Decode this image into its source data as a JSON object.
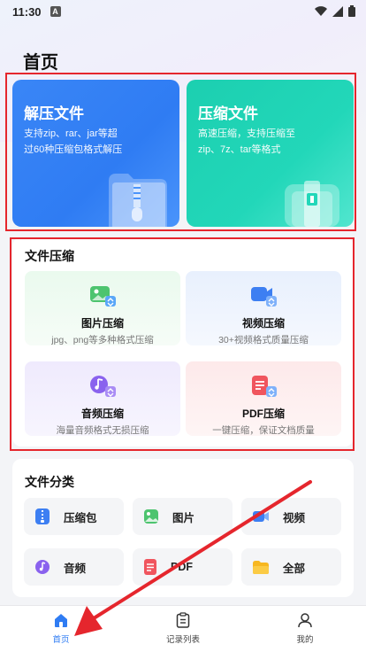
{
  "status_bar": {
    "time": "11:30",
    "notification_badge": "A"
  },
  "page_title": "首页",
  "hero_cards": [
    {
      "title": "解压文件",
      "desc_line1": "支持zip、rar、jar等超",
      "desc_line2": "过60种压缩包格式解压",
      "color": "#2f7cf3",
      "icon": "zip-folder-icon"
    },
    {
      "title": "压缩文件",
      "desc_line1": "高速压缩，支持压缩至",
      "desc_line2": "zip、7z、tar等格式",
      "color": "#1ccfb0",
      "icon": "compress-box-icon"
    }
  ],
  "compress_section": {
    "title": "文件压缩",
    "tools": [
      {
        "name": "图片压缩",
        "desc": "jpg、png等多种格式压缩",
        "icon": "image-compress-icon",
        "bg": "#eefaf1"
      },
      {
        "name": "视频压缩",
        "desc": "30+视频格式质量压缩",
        "icon": "video-compress-icon",
        "bg": "#edf3fd"
      },
      {
        "name": "音频压缩",
        "desc": "海量音频格式无损压缩",
        "icon": "audio-compress-icon",
        "bg": "#f2effd"
      },
      {
        "name": "PDF压缩",
        "desc": "一键压缩，保证文档质量",
        "icon": "pdf-compress-icon",
        "bg": "#fdeff0"
      }
    ]
  },
  "category_section": {
    "title": "文件分类",
    "items": [
      {
        "label": "压缩包",
        "icon": "archive-icon"
      },
      {
        "label": "图片",
        "icon": "image-icon"
      },
      {
        "label": "视频",
        "icon": "video-icon"
      },
      {
        "label": "音频",
        "icon": "music-icon"
      },
      {
        "label": "PDF",
        "icon": "pdf-icon"
      },
      {
        "label": "全部",
        "icon": "folder-icon"
      }
    ]
  },
  "tab_bar": {
    "tabs": [
      {
        "label": "首页",
        "icon": "home-icon",
        "active": true
      },
      {
        "label": "记录列表",
        "icon": "clipboard-icon",
        "active": false
      },
      {
        "label": "我的",
        "icon": "user-icon",
        "active": false
      }
    ]
  },
  "colors": {
    "accent": "#2f7cf3",
    "annotation_red": "#e5262d"
  }
}
